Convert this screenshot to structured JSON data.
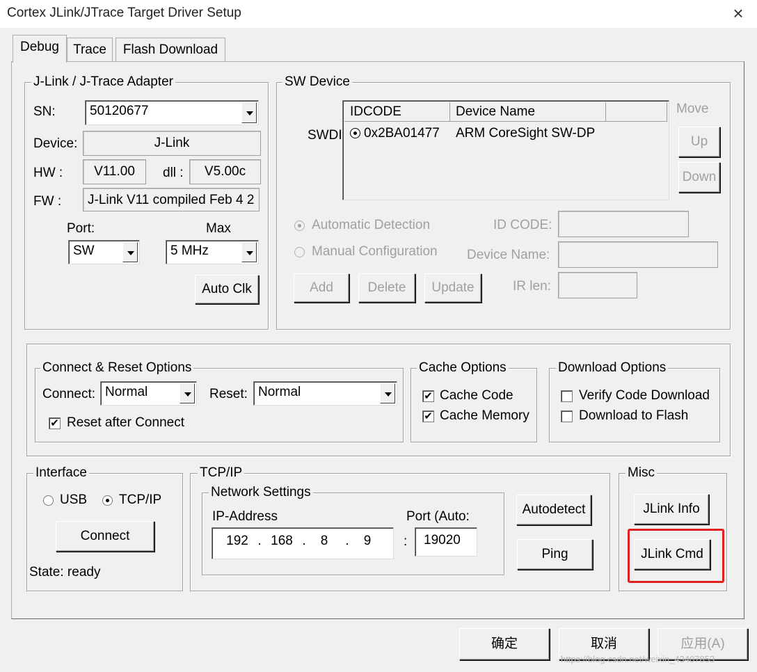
{
  "window": {
    "title": "Cortex JLink/JTrace Target Driver Setup",
    "close_glyph": "×"
  },
  "tabs": [
    {
      "label": "Debug",
      "active": true
    },
    {
      "label": "Trace",
      "active": false
    },
    {
      "label": "Flash Download",
      "active": false
    }
  ],
  "adapter": {
    "group_label": "J-Link / J-Trace Adapter",
    "sn_label": "SN:",
    "sn_value": "50120677",
    "device_label": "Device:",
    "device_value": "J-Link",
    "hw_label": "HW :",
    "hw_value": "V11.00",
    "dll_label": "dll :",
    "dll_value": "V5.00c",
    "fw_label": "FW :",
    "fw_value": "J-Link V11 compiled Feb  4 2",
    "port_label": "Port:",
    "port_value": "SW",
    "max_label": "Max",
    "max_value": "5 MHz",
    "auto_clk_label": "Auto Clk"
  },
  "sw_device": {
    "group_label": "SW Device",
    "swdi_label": "SWDI",
    "columns": [
      "IDCODE",
      "Device Name"
    ],
    "rows": [
      {
        "idcode": "0x2BA01477",
        "device_name": "ARM CoreSight SW-DP"
      }
    ],
    "move_label": "Move",
    "up_label": "Up",
    "down_label": "Down",
    "auto_detect_label": "Automatic Detection",
    "manual_config_label": "Manual Configuration",
    "id_code_label": "ID CODE:",
    "device_name_label": "Device Name:",
    "ir_len_label": "IR len:",
    "add_label": "Add",
    "delete_label": "Delete",
    "update_label": "Update"
  },
  "connect_reset": {
    "group_label": "Connect & Reset Options",
    "connect_label": "Connect:",
    "connect_value": "Normal",
    "reset_label": "Reset:",
    "reset_value": "Normal",
    "reset_after_connect_label": "Reset after Connect",
    "reset_after_connect_checked": true
  },
  "cache": {
    "group_label": "Cache Options",
    "cache_code_label": "Cache Code",
    "cache_code_checked": true,
    "cache_memory_label": "Cache Memory",
    "cache_memory_checked": true
  },
  "download": {
    "group_label": "Download Options",
    "verify_label": "Verify Code Download",
    "verify_checked": false,
    "to_flash_label": "Download to Flash",
    "to_flash_checked": false
  },
  "interface": {
    "group_label": "Interface",
    "usb_label": "USB",
    "tcpip_label": "TCP/IP",
    "selected": "TCP/IP",
    "connect_label": "Connect",
    "state_text": "State: ready"
  },
  "tcpip": {
    "group_label": "TCP/IP",
    "network_label": "Network Settings",
    "ip_label": "IP-Address",
    "ip_octets": [
      "192",
      "168",
      "8",
      "9"
    ],
    "ip_dot": ".",
    "port_label": "Port (Auto:",
    "port_sep": ":",
    "port_value": "19020",
    "autodetect_label": "Autodetect",
    "ping_label": "Ping"
  },
  "misc": {
    "group_label": "Misc",
    "jlink_info_label": "JLink Info",
    "jlink_cmd_label": "JLink Cmd",
    "highlight_color": "#e02020"
  },
  "footer": {
    "ok_label": "确定",
    "cancel_label": "取消",
    "apply_label": "应用(A)",
    "watermark": "https://blog.csdn.net/weixin_43407853"
  },
  "icons": {
    "check": "check-icon",
    "dropdown": "chevron-down-icon",
    "close": "close-icon"
  }
}
